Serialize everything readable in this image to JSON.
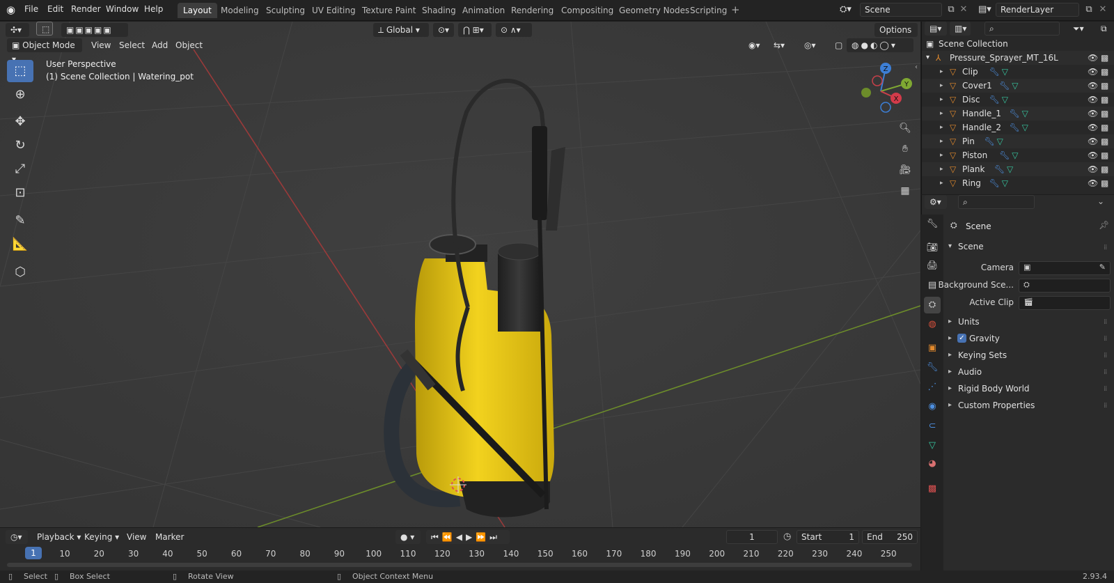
{
  "topbar": {
    "menus": [
      "File",
      "Edit",
      "Render",
      "Window",
      "Help"
    ],
    "workspaces": [
      "Layout",
      "Modeling",
      "Sculpting",
      "UV Editing",
      "Texture Paint",
      "Shading",
      "Animation",
      "Rendering",
      "Compositing",
      "Geometry Nodes",
      "Scripting"
    ],
    "active_workspace": "Layout",
    "scene_name": "Scene",
    "view_layer": "RenderLayer"
  },
  "viewport": {
    "transform_orientation": "Global",
    "options_label": "Options",
    "mode": "Object Mode",
    "menus": [
      "View",
      "Select",
      "Add",
      "Object"
    ],
    "overlay_line1": "User Perspective",
    "overlay_line2": "(1) Scene Collection | Watering_pot",
    "gizmo": {
      "z": "Z",
      "y": "Y",
      "x": "X"
    }
  },
  "timeline": {
    "menus": [
      "Playback",
      "Keying",
      "View",
      "Marker"
    ],
    "current_frame": "1",
    "start_label": "Start",
    "start_value": "1",
    "end_label": "End",
    "end_value": "250",
    "ticks": [
      "1",
      "10",
      "20",
      "30",
      "40",
      "50",
      "60",
      "70",
      "80",
      "90",
      "100",
      "110",
      "120",
      "130",
      "140",
      "150",
      "160",
      "170",
      "180",
      "190",
      "200",
      "210",
      "220",
      "230",
      "240",
      "250"
    ]
  },
  "statusbar": {
    "select": "Select",
    "box_select": "Box Select",
    "rotate_view": "Rotate View",
    "context_menu": "Object Context Menu",
    "version": "2.93.4"
  },
  "outliner": {
    "root": "Scene Collection",
    "collection": "Pressure_Sprayer_MT_16L",
    "items": [
      "Clip",
      "Cover1",
      "Disc",
      "Handle_1",
      "Handle_2",
      "Pin",
      "Piston",
      "Plank",
      "Ring"
    ]
  },
  "properties": {
    "header": "Scene",
    "section": "Scene",
    "camera_label": "Camera",
    "background_label": "Background Sce...",
    "active_clip_label": "Active Clip",
    "panels": [
      "Units",
      "Gravity",
      "Keying Sets",
      "Audio",
      "Rigid Body World",
      "Custom Properties"
    ]
  },
  "colors": {
    "accent": "#4772b3",
    "axis_x": "#c8404a",
    "axis_y": "#7fa832",
    "axis_z": "#3d7fd6",
    "sprayer_yellow": "#e8c81a",
    "mesh_icon": "#e2892c"
  }
}
